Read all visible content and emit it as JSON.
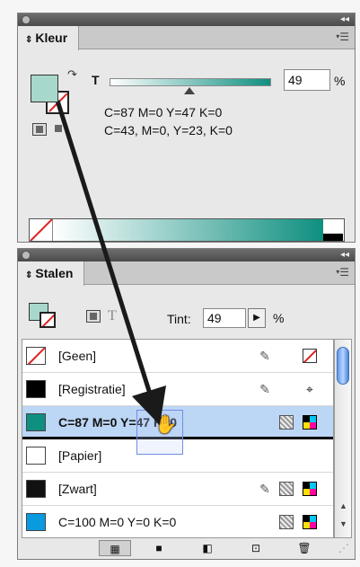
{
  "kleur": {
    "tab_label": "Kleur",
    "tint_label": "T",
    "tint_value": "49",
    "tint_unit": "%",
    "tint_fraction": 0.49,
    "line1": "C=87 M=0 Y=47 K=0",
    "line2": "C=43, M=0, Y=23, K=0",
    "fill_color": "#a8d8cc",
    "ramp_color": "#0f8f80"
  },
  "stalen": {
    "tab_label": "Stalen",
    "tint_label": "Tint:",
    "tint_value": "49",
    "tint_unit": "%",
    "swatches": [
      {
        "name": "[Geen]",
        "color": "none",
        "icons": [
          "pencil-none-icon",
          "none-swatch-icon"
        ]
      },
      {
        "name": "[Registratie]",
        "color": "#000000",
        "icons": [
          "pencil-none-icon",
          "registration-icon"
        ]
      },
      {
        "name": "C=87 M=0 Y=47 K=0",
        "color": "#0f8f80",
        "icons": [
          "process-icon",
          "cmyk-icon"
        ],
        "selected": true
      },
      {
        "name": "[Papier]",
        "color": "#ffffff",
        "icons": []
      },
      {
        "name": "[Zwart]",
        "color": "#111111",
        "icons": [
          "pencil-none-icon",
          "process-icon",
          "cmyk-icon"
        ]
      },
      {
        "name": "C=100 M=0 Y=0 K=0",
        "color": "#0a9ae0",
        "icons": [
          "process-icon",
          "cmyk-icon"
        ]
      }
    ]
  },
  "colors": {
    "none_red": "#e02020",
    "selection": "#bcd6f5",
    "arrow": "#1a1a1a"
  }
}
